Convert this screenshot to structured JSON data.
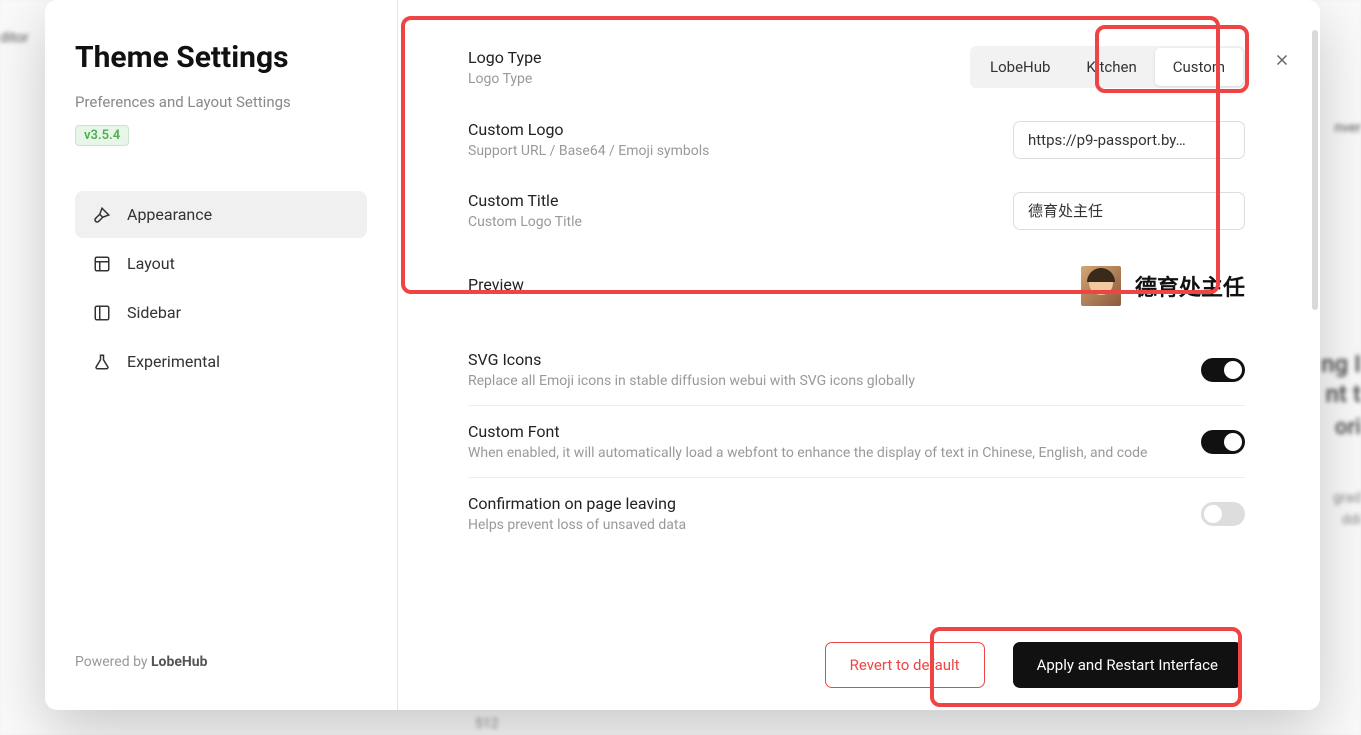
{
  "background": {
    "editor": "ditor",
    "inver": "nver",
    "ngText": "ng I",
    "ntText": "nt t",
    "oriText": "ori",
    "gradText": "grad",
    "ddiText": "ddi",
    "num": "512"
  },
  "sidebar": {
    "title": "Theme Settings",
    "subtitle": "Preferences and Layout Settings",
    "version": "v3.5.4",
    "nav": [
      {
        "label": "Appearance",
        "active": true
      },
      {
        "label": "Layout",
        "active": false
      },
      {
        "label": "Sidebar",
        "active": false
      },
      {
        "label": "Experimental",
        "active": false
      }
    ],
    "poweredBy": "Powered by ",
    "poweredByBrand": "LobeHub"
  },
  "settings": {
    "logoType": {
      "title": "Logo Type",
      "desc": "Logo Type",
      "options": [
        "LobeHub",
        "Kitchen",
        "Custom"
      ],
      "selected": "Custom"
    },
    "customLogo": {
      "title": "Custom Logo",
      "desc": "Support URL / Base64 / Emoji symbols",
      "value": "https://p9-passport.by…"
    },
    "customTitle": {
      "title": "Custom Title",
      "desc": "Custom Logo Title",
      "value": "德育处主任"
    },
    "preview": {
      "title": "Preview",
      "displayTitle": "德育处主任"
    },
    "svgIcons": {
      "title": "SVG Icons",
      "desc": "Replace all Emoji icons in stable diffusion webui with SVG icons globally",
      "enabled": true
    },
    "customFont": {
      "title": "Custom Font",
      "desc": "When enabled, it will automatically load a webfont to enhance the display of text in Chinese, English, and code",
      "enabled": true
    },
    "confirmation": {
      "title": "Confirmation on page leaving",
      "desc": "Helps prevent loss of unsaved data",
      "enabled": false
    }
  },
  "actions": {
    "revert": "Revert to default",
    "apply": "Apply and Restart Interface"
  }
}
